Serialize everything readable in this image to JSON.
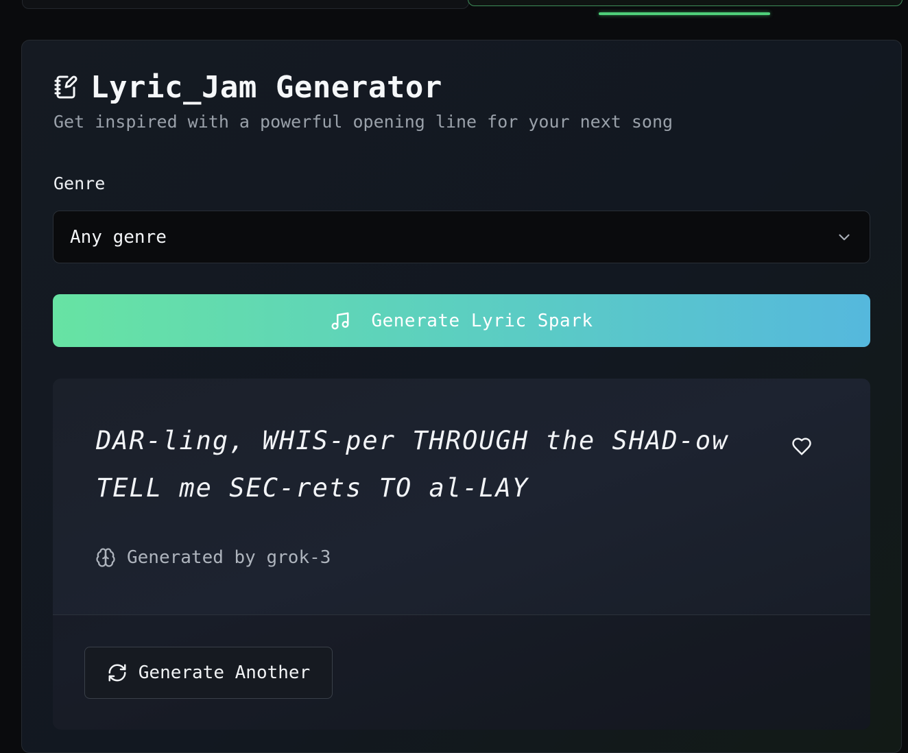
{
  "header": {
    "title": "Lyric_Jam Generator",
    "subtitle": "Get inspired with a powerful opening line for your next song",
    "icon": "notebook-pen-icon"
  },
  "form": {
    "genre_label": "Genre",
    "genre_selected": "Any genre",
    "generate_button_label": "Generate Lyric Spark",
    "generate_button_icon": "music-note-icon"
  },
  "result": {
    "lyric_lines": [
      "DAR-ling, WHIS-per THROUGH the SHAD-ow",
      "TELL me SEC-rets TO al-LAY"
    ],
    "generated_by": "Generated by grok-3",
    "another_button_label": "Generate Another",
    "another_button_icon": "refresh-icon",
    "favorite_icon": "heart-icon",
    "model_icon": "brain-icon"
  },
  "colors": {
    "accent_green": "#4fd07a",
    "gradient_start": "#67e3a3",
    "gradient_end": "#55b8dd",
    "background": "#0a0b0d"
  }
}
